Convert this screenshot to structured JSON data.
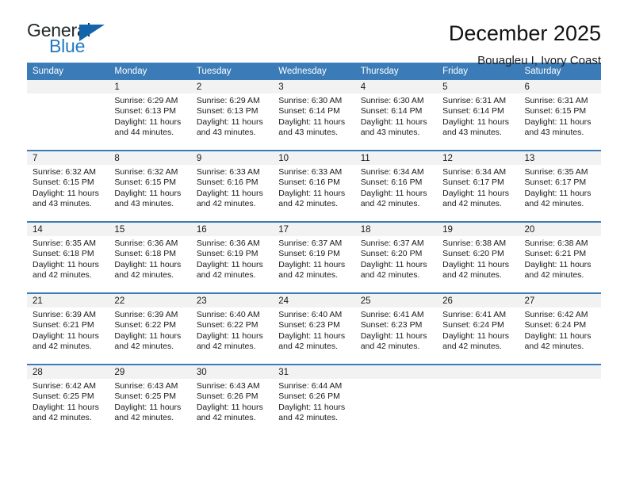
{
  "logo": {
    "primary_text": "General",
    "secondary_text": "Blue",
    "icon": "triangle-icon",
    "primary_color": "#24292b",
    "secondary_color": "#2079c4",
    "triangle_color": "#1464ab"
  },
  "header": {
    "title": "December 2025",
    "subtitle": "Bouagleu I, Ivory Coast"
  },
  "theme": {
    "header_row_bg": "#3b7cb8",
    "daynum_bg": "#f2f2f2",
    "cell_bg": "#ffffff",
    "text": "#1a1a1a"
  },
  "calendar": {
    "weekday_headers": [
      "Sunday",
      "Monday",
      "Tuesday",
      "Wednesday",
      "Thursday",
      "Friday",
      "Saturday"
    ],
    "weeks": [
      [
        {
          "day": "",
          "sunrise": "",
          "sunset": "",
          "daylight_1": "",
          "daylight_2": ""
        },
        {
          "day": "1",
          "sunrise": "Sunrise: 6:29 AM",
          "sunset": "Sunset: 6:13 PM",
          "daylight_1": "Daylight: 11 hours",
          "daylight_2": "and 44 minutes."
        },
        {
          "day": "2",
          "sunrise": "Sunrise: 6:29 AM",
          "sunset": "Sunset: 6:13 PM",
          "daylight_1": "Daylight: 11 hours",
          "daylight_2": "and 43 minutes."
        },
        {
          "day": "3",
          "sunrise": "Sunrise: 6:30 AM",
          "sunset": "Sunset: 6:14 PM",
          "daylight_1": "Daylight: 11 hours",
          "daylight_2": "and 43 minutes."
        },
        {
          "day": "4",
          "sunrise": "Sunrise: 6:30 AM",
          "sunset": "Sunset: 6:14 PM",
          "daylight_1": "Daylight: 11 hours",
          "daylight_2": "and 43 minutes."
        },
        {
          "day": "5",
          "sunrise": "Sunrise: 6:31 AM",
          "sunset": "Sunset: 6:14 PM",
          "daylight_1": "Daylight: 11 hours",
          "daylight_2": "and 43 minutes."
        },
        {
          "day": "6",
          "sunrise": "Sunrise: 6:31 AM",
          "sunset": "Sunset: 6:15 PM",
          "daylight_1": "Daylight: 11 hours",
          "daylight_2": "and 43 minutes."
        }
      ],
      [
        {
          "day": "7",
          "sunrise": "Sunrise: 6:32 AM",
          "sunset": "Sunset: 6:15 PM",
          "daylight_1": "Daylight: 11 hours",
          "daylight_2": "and 43 minutes."
        },
        {
          "day": "8",
          "sunrise": "Sunrise: 6:32 AM",
          "sunset": "Sunset: 6:15 PM",
          "daylight_1": "Daylight: 11 hours",
          "daylight_2": "and 43 minutes."
        },
        {
          "day": "9",
          "sunrise": "Sunrise: 6:33 AM",
          "sunset": "Sunset: 6:16 PM",
          "daylight_1": "Daylight: 11 hours",
          "daylight_2": "and 42 minutes."
        },
        {
          "day": "10",
          "sunrise": "Sunrise: 6:33 AM",
          "sunset": "Sunset: 6:16 PM",
          "daylight_1": "Daylight: 11 hours",
          "daylight_2": "and 42 minutes."
        },
        {
          "day": "11",
          "sunrise": "Sunrise: 6:34 AM",
          "sunset": "Sunset: 6:16 PM",
          "daylight_1": "Daylight: 11 hours",
          "daylight_2": "and 42 minutes."
        },
        {
          "day": "12",
          "sunrise": "Sunrise: 6:34 AM",
          "sunset": "Sunset: 6:17 PM",
          "daylight_1": "Daylight: 11 hours",
          "daylight_2": "and 42 minutes."
        },
        {
          "day": "13",
          "sunrise": "Sunrise: 6:35 AM",
          "sunset": "Sunset: 6:17 PM",
          "daylight_1": "Daylight: 11 hours",
          "daylight_2": "and 42 minutes."
        }
      ],
      [
        {
          "day": "14",
          "sunrise": "Sunrise: 6:35 AM",
          "sunset": "Sunset: 6:18 PM",
          "daylight_1": "Daylight: 11 hours",
          "daylight_2": "and 42 minutes."
        },
        {
          "day": "15",
          "sunrise": "Sunrise: 6:36 AM",
          "sunset": "Sunset: 6:18 PM",
          "daylight_1": "Daylight: 11 hours",
          "daylight_2": "and 42 minutes."
        },
        {
          "day": "16",
          "sunrise": "Sunrise: 6:36 AM",
          "sunset": "Sunset: 6:19 PM",
          "daylight_1": "Daylight: 11 hours",
          "daylight_2": "and 42 minutes."
        },
        {
          "day": "17",
          "sunrise": "Sunrise: 6:37 AM",
          "sunset": "Sunset: 6:19 PM",
          "daylight_1": "Daylight: 11 hours",
          "daylight_2": "and 42 minutes."
        },
        {
          "day": "18",
          "sunrise": "Sunrise: 6:37 AM",
          "sunset": "Sunset: 6:20 PM",
          "daylight_1": "Daylight: 11 hours",
          "daylight_2": "and 42 minutes."
        },
        {
          "day": "19",
          "sunrise": "Sunrise: 6:38 AM",
          "sunset": "Sunset: 6:20 PM",
          "daylight_1": "Daylight: 11 hours",
          "daylight_2": "and 42 minutes."
        },
        {
          "day": "20",
          "sunrise": "Sunrise: 6:38 AM",
          "sunset": "Sunset: 6:21 PM",
          "daylight_1": "Daylight: 11 hours",
          "daylight_2": "and 42 minutes."
        }
      ],
      [
        {
          "day": "21",
          "sunrise": "Sunrise: 6:39 AM",
          "sunset": "Sunset: 6:21 PM",
          "daylight_1": "Daylight: 11 hours",
          "daylight_2": "and 42 minutes."
        },
        {
          "day": "22",
          "sunrise": "Sunrise: 6:39 AM",
          "sunset": "Sunset: 6:22 PM",
          "daylight_1": "Daylight: 11 hours",
          "daylight_2": "and 42 minutes."
        },
        {
          "day": "23",
          "sunrise": "Sunrise: 6:40 AM",
          "sunset": "Sunset: 6:22 PM",
          "daylight_1": "Daylight: 11 hours",
          "daylight_2": "and 42 minutes."
        },
        {
          "day": "24",
          "sunrise": "Sunrise: 6:40 AM",
          "sunset": "Sunset: 6:23 PM",
          "daylight_1": "Daylight: 11 hours",
          "daylight_2": "and 42 minutes."
        },
        {
          "day": "25",
          "sunrise": "Sunrise: 6:41 AM",
          "sunset": "Sunset: 6:23 PM",
          "daylight_1": "Daylight: 11 hours",
          "daylight_2": "and 42 minutes."
        },
        {
          "day": "26",
          "sunrise": "Sunrise: 6:41 AM",
          "sunset": "Sunset: 6:24 PM",
          "daylight_1": "Daylight: 11 hours",
          "daylight_2": "and 42 minutes."
        },
        {
          "day": "27",
          "sunrise": "Sunrise: 6:42 AM",
          "sunset": "Sunset: 6:24 PM",
          "daylight_1": "Daylight: 11 hours",
          "daylight_2": "and 42 minutes."
        }
      ],
      [
        {
          "day": "28",
          "sunrise": "Sunrise: 6:42 AM",
          "sunset": "Sunset: 6:25 PM",
          "daylight_1": "Daylight: 11 hours",
          "daylight_2": "and 42 minutes."
        },
        {
          "day": "29",
          "sunrise": "Sunrise: 6:43 AM",
          "sunset": "Sunset: 6:25 PM",
          "daylight_1": "Daylight: 11 hours",
          "daylight_2": "and 42 minutes."
        },
        {
          "day": "30",
          "sunrise": "Sunrise: 6:43 AM",
          "sunset": "Sunset: 6:26 PM",
          "daylight_1": "Daylight: 11 hours",
          "daylight_2": "and 42 minutes."
        },
        {
          "day": "31",
          "sunrise": "Sunrise: 6:44 AM",
          "sunset": "Sunset: 6:26 PM",
          "daylight_1": "Daylight: 11 hours",
          "daylight_2": "and 42 minutes."
        },
        {
          "day": "",
          "sunrise": "",
          "sunset": "",
          "daylight_1": "",
          "daylight_2": ""
        },
        {
          "day": "",
          "sunrise": "",
          "sunset": "",
          "daylight_1": "",
          "daylight_2": ""
        },
        {
          "day": "",
          "sunrise": "",
          "sunset": "",
          "daylight_1": "",
          "daylight_2": ""
        }
      ]
    ]
  }
}
